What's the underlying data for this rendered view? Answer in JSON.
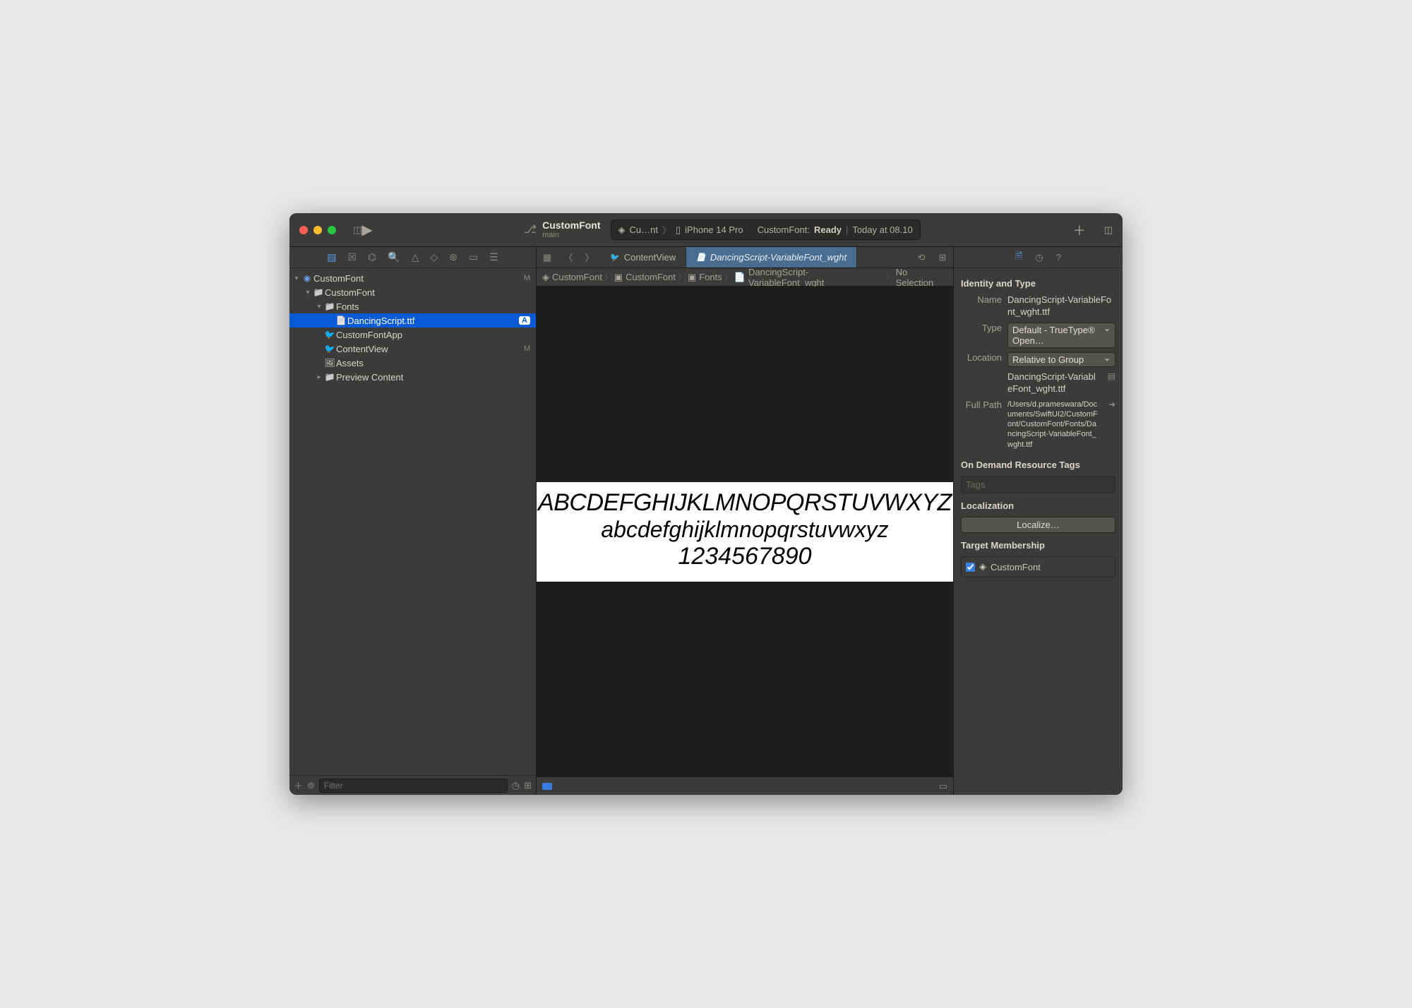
{
  "titlebar": {
    "project": "CustomFont",
    "branch": "main",
    "scheme_app": "Cu…nt",
    "device": "iPhone 14 Pro",
    "status_project": "CustomFont:",
    "status_state": "Ready",
    "status_time": "Today at 08.10"
  },
  "navigator": {
    "filter_placeholder": "Filter",
    "tree": {
      "root": {
        "label": "CustomFont",
        "status": "M"
      },
      "group": {
        "label": "CustomFont"
      },
      "fonts_folder": {
        "label": "Fonts"
      },
      "font_file": {
        "label": "DancingScript.ttf",
        "status": "A"
      },
      "app_file": {
        "label": "CustomFontApp"
      },
      "content_view": {
        "label": "ContentView",
        "status": "M"
      },
      "assets": {
        "label": "Assets"
      },
      "preview_content": {
        "label": "Preview Content"
      }
    }
  },
  "tabs": {
    "tab1": "ContentView",
    "tab2": "DancingScript-VariableFont_wght"
  },
  "pathbar": {
    "c1": "CustomFont",
    "c2": "CustomFont",
    "c3": "Fonts",
    "c4": "DancingScript-VariableFont_wght",
    "c5": "No Selection"
  },
  "preview": {
    "upper": "ABCDEFGHIJKLMNOPQRSTUVWXYZ",
    "lower": "abcdefghijklmnopqrstuvwxyz",
    "digits": "1234567890"
  },
  "inspector": {
    "section_identity": "Identity and Type",
    "name_label": "Name",
    "name_value": "DancingScript-VariableFont_wght.ttf",
    "type_label": "Type",
    "type_value": "Default - TrueType® Open…",
    "location_label": "Location",
    "location_value": "Relative to Group",
    "location_path": "DancingScript-VariableFont_wght.ttf",
    "fullpath_label": "Full Path",
    "fullpath_value": "/Users/d.prameswara/Documents/SwiftUI2/CustomFont/CustomFont/Fonts/DancingScript-VariableFont_wght.ttf",
    "section_odr": "On Demand Resource Tags",
    "tags_placeholder": "Tags",
    "section_localization": "Localization",
    "localize_button": "Localize…",
    "section_target": "Target Membership",
    "target_name": "CustomFont"
  }
}
